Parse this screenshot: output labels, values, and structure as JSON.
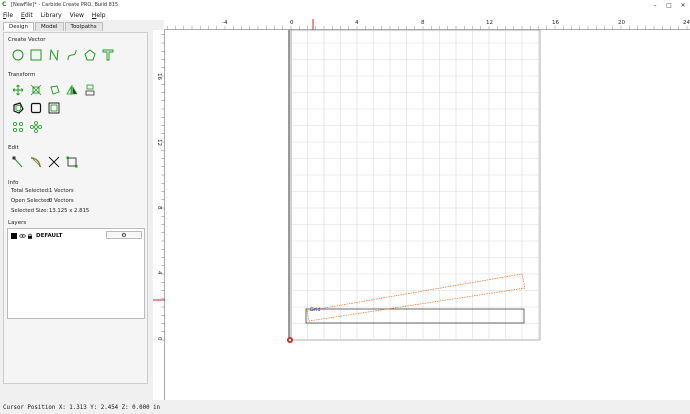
{
  "window": {
    "title": "[NewFile]* - Carbide Create PRO, Build 815",
    "icon": "carbide-create-icon"
  },
  "window_controls": {
    "minimize": "–",
    "maximize": "□",
    "close": "✕"
  },
  "menu": [
    {
      "prefix": "",
      "accel": "F",
      "rest": "ile"
    },
    {
      "prefix": "",
      "accel": "E",
      "rest": "dit"
    },
    {
      "prefix": "",
      "accel": "",
      "rest": "Library"
    },
    {
      "prefix": "",
      "accel": "",
      "rest": "View"
    },
    {
      "prefix": "",
      "accel": "H",
      "rest": "elp"
    }
  ],
  "tabs": [
    "Design",
    "Model",
    "Toolpaths"
  ],
  "active_tab": "Design",
  "sections": {
    "create_vector": "Create Vector",
    "transform": "Transform",
    "edit": "Edit",
    "info": "Info",
    "layers": "Layers"
  },
  "info": {
    "total_selected_label": "Total Selected:",
    "total_selected_value": "1 Vectors",
    "open_selected_label": "Open Selected:",
    "open_selected_value": "0 Vectors",
    "selected_size_label": "Selected Size:",
    "selected_size_value": "13.125 x 2.815"
  },
  "layers": [
    {
      "name": "DEFAULT",
      "color": "#000000"
    }
  ],
  "ruler_top": [
    "-4",
    "0",
    "4",
    "8",
    "12",
    "16",
    "20",
    "24"
  ],
  "ruler_left": [
    "16",
    "12",
    "8",
    "4",
    "0"
  ],
  "canvas": {
    "text_label": "Grid",
    "accent": "#1a9a1a",
    "selection_color": "#e07020",
    "marker_color": "#e02020"
  },
  "status": {
    "text": "Cursor Position X: 1.313 Y: 2.454 Z: 0.000 in"
  }
}
